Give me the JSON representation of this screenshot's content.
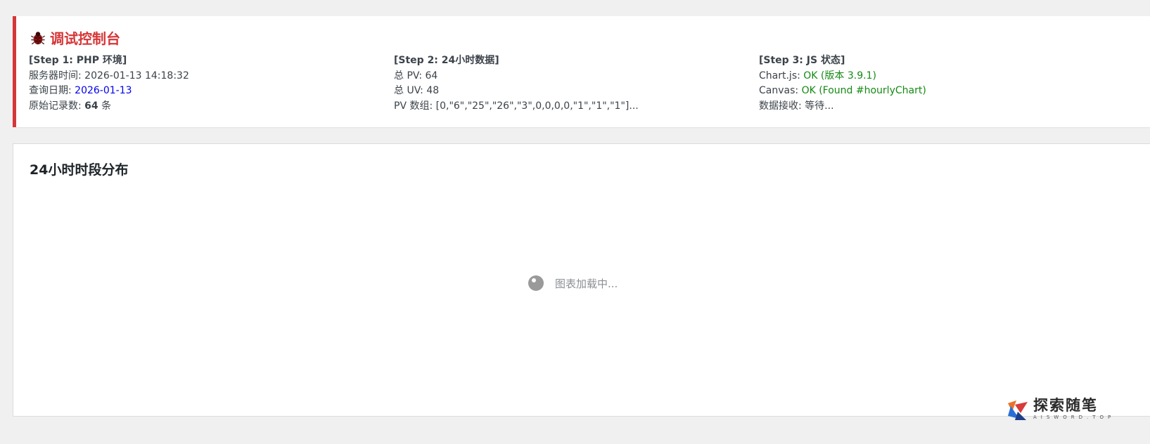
{
  "debug": {
    "title": "调试控制台",
    "step1": {
      "header": "[Step 1: PHP 环境]",
      "server_time_label": "服务器时间: ",
      "server_time_value": "2026-01-13 14:18:32",
      "query_date_label": "查询日期: ",
      "query_date_value": "2026-01-13",
      "raw_count_label": "原始记录数: ",
      "raw_count_value": "64",
      "raw_count_unit": " 条"
    },
    "step2": {
      "header": "[Step 2: 24小时数据]",
      "pv_label": "总 PV: ",
      "pv_value": "64",
      "uv_label": "总 UV: ",
      "uv_value": "48",
      "pv_array_label": "PV 数组: ",
      "pv_array_value": "[0,\"6\",\"25\",\"26\",\"3\",0,0,0,0,\"1\",\"1\",\"1\"]..."
    },
    "step3": {
      "header": "[Step 3: JS 状态]",
      "chartjs_label": "Chart.js: ",
      "chartjs_value": "OK (版本 3.9.1)",
      "canvas_label": "Canvas: ",
      "canvas_value": "OK (Found #hourlyChart)",
      "data_label": "数据接收: ",
      "data_value": "等待..."
    }
  },
  "chart_panel": {
    "title": "24小时时段分布",
    "loading_text": "图表加载中..."
  },
  "watermark": {
    "cn": "探索随笔",
    "en": "AISWORD.TOP"
  },
  "colors": {
    "accent_red": "#d63638",
    "link_blue": "#0000ee",
    "ok_green": "#148a14"
  }
}
